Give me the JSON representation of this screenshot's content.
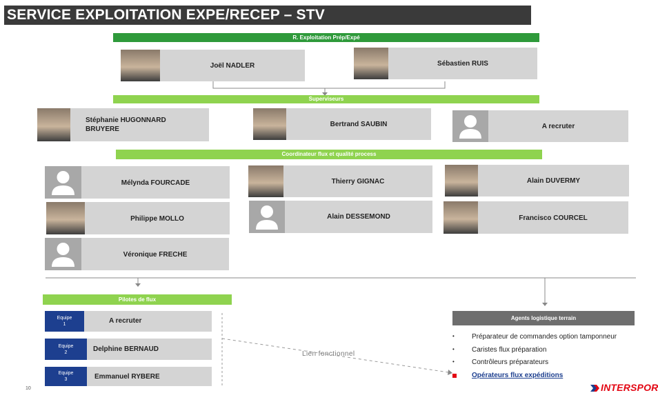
{
  "title": "SERVICE EXPLOITATION EXPE/RECEP – STV",
  "bands": {
    "r_exploitation": "R. Exploitation Prép/Expé",
    "superviseurs": "Superviseurs",
    "coordinateur": "Coordinateur flux et qualité process",
    "pilotes": "Pilotes de flux",
    "agents": "Agents logistique terrain"
  },
  "managers": [
    "Joël NADLER",
    "Sébastien RUIS"
  ],
  "superviseurs": [
    "Stéphanie HUGONNARD\nBRUYERE",
    "Bertrand SAUBIN",
    "A recruter"
  ],
  "coordinateurs": [
    "Mélynda FOURCADE",
    "Thierry GIGNAC",
    "Alain DUVERMY",
    "Philippe MOLLO",
    "Alain DESSEMOND",
    "Francisco COURCEL",
    "Véronique FRECHE"
  ],
  "pilotes": [
    {
      "equipe": "Equipe\n1",
      "name": "A recruter"
    },
    {
      "equipe": "Equipe\n2",
      "name": "Delphine BERNAUD"
    },
    {
      "equipe": "Equipe\n3",
      "name": "Emmanuel RYBERE"
    }
  ],
  "agents_list": [
    "Préparateur de commandes option tamponneur",
    "Caristes flux préparation",
    "Contrôleurs préparateurs"
  ],
  "agents_link": "Opérateurs flux expéditions",
  "lien_label": "Lien fonctionnel",
  "page_number": "10",
  "logo": "INTERSPORT",
  "colors": {
    "title_bg": "#3a3a3a",
    "band_dark_green": "#2f9a3b",
    "band_light_green": "#8fd34f",
    "card_bg": "#d4d4d4",
    "equipe_blue": "#1d3f8f",
    "brand_red": "#e30613"
  }
}
